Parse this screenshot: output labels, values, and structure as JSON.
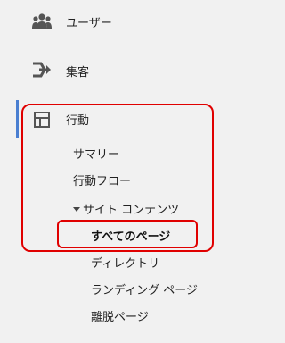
{
  "nav": {
    "items": [
      {
        "label": "ユーザー",
        "icon": "users-icon"
      },
      {
        "label": "集客",
        "icon": "acquisition-arrows-icon"
      },
      {
        "label": "行動",
        "icon": "behavior-layout-icon"
      }
    ],
    "behavior_children": [
      {
        "label": "サマリー"
      },
      {
        "label": "行動フロー"
      },
      {
        "label": "サイト コンテンツ",
        "expanded": true
      }
    ],
    "site_content_children": [
      {
        "label": "すべてのページ",
        "selected": true
      },
      {
        "label": "ディレクトリ"
      },
      {
        "label": "ランディング ページ"
      },
      {
        "label": "離脱ページ"
      }
    ]
  },
  "colors": {
    "background": "#f1f1f1",
    "active_indicator": "#4a7fd1",
    "highlight": "#e00000",
    "icon": "#555555"
  }
}
